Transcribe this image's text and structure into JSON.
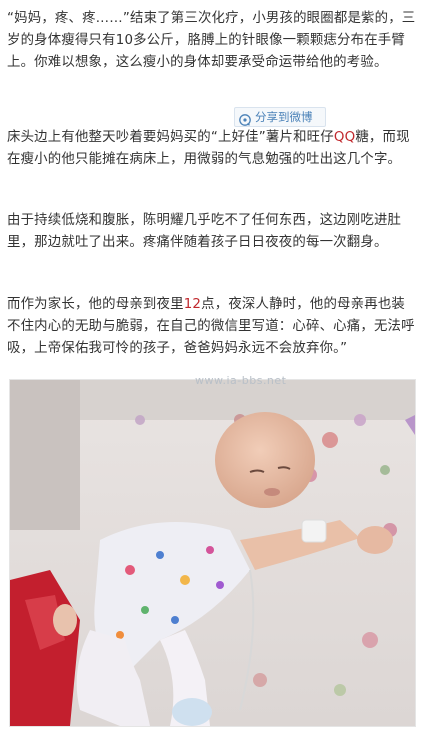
{
  "paragraphs": [
    {
      "text": "“妈妈，疼、疼……”结束了第三次化疗，小男孩的眼圈都是紫的，三岁的身体瘦得只有10多公斤，胳膊上的针眼像一颗颗痣分布在手臂上。你难以想象，这么瘦小的身体却要承受命运带给他的考验。"
    },
    {
      "before": "床头边上有他整天吵着要妈妈买的“上好佳”薯片和旺仔",
      "highlight": "QQ",
      "after": "糖，而现在瘦小的他只能摊在病床上，用微弱的气息勉强的吐出这几个字。"
    },
    {
      "text": "由于持续低烧和腹胀，陈明耀几乎吃不了任何东西，这边刚吃进肚里，那边就吐了出来。疼痛伴随着孩子日日夜夜的每一次翻身。"
    },
    {
      "before": "而作为家长，他的母亲到夜里",
      "highlight": "12",
      "after": "点，夜深人静时，他的母亲再也装不住内心的无助与脆弱，在自己的微信里写道：心碎、心痛，无法呼吸，上帝保佑我可怜的孩子，爸爸妈妈永远不会放弃你。”"
    }
  ],
  "share": {
    "label": "分享到微博",
    "icon": "weibo-icon"
  },
  "watermark": "www.ia-bbs.net",
  "photo": {
    "icon": "photo-child-in-bed"
  },
  "colors": {
    "text": "#333333",
    "highlight": "#c0282d",
    "share_text": "#4b82b8"
  }
}
